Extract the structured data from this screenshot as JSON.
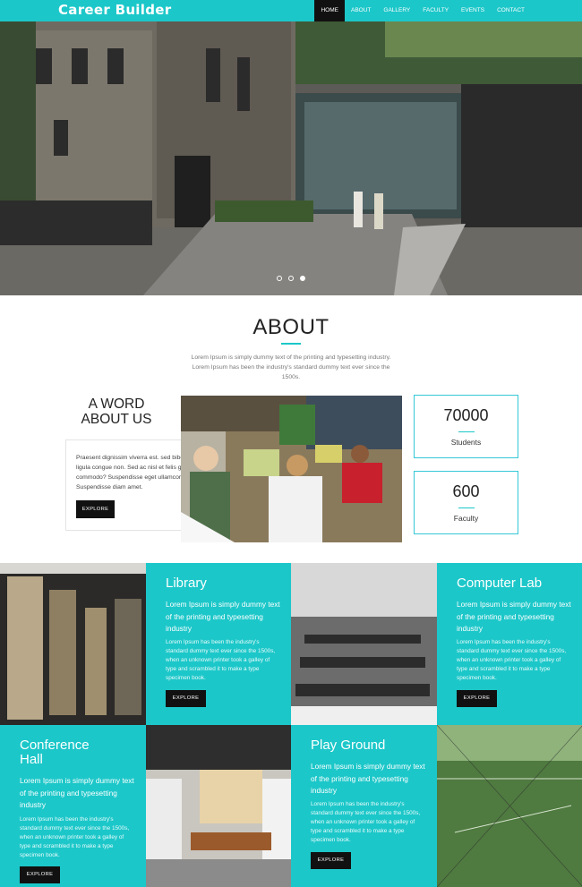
{
  "nav": {
    "logo": "Career Builder",
    "items": [
      "HOME",
      "ABOUT",
      "GALLERY",
      "FACULTY",
      "EVENTS",
      "CONTACT"
    ],
    "active_index": 0
  },
  "hero": {
    "slide_count": 3,
    "active_slide": 3
  },
  "about": {
    "title": "ABOUT",
    "text": "Lorem Ipsum is simply dummy text of the printing and typesetting industry. Lorem Ipsum has been the industry's standard dummy text ever since the 1500s.",
    "word_title_line1": "A WORD",
    "word_title_line2": "ABOUT US",
    "word_text": "Praesent dignissim viverra est. sed bibendum ligula congue non. Sed ac nisl et felis gravida commodo? Suspendisse eget ullamcorper sem. Suspendisse diam amet.",
    "explore_label": "EXPLORE"
  },
  "stats": [
    {
      "value": "70000",
      "label": "Students"
    },
    {
      "value": "600",
      "label": "Faculty"
    }
  ],
  "facilities": [
    {
      "title": "Library",
      "lead": "Lorem Ipsum is simply dummy text of the printing and typesetting industry",
      "body": "Lorem Ipsum has been the industry's standard dummy text ever since the 1500s, when an unknown printer took a galley of type and scrambled it to make a type specimen book.",
      "button": "EXPLORE"
    },
    {
      "title": "Computer Lab",
      "lead": "Lorem Ipsum is simply dummy text of the printing and typesetting industry",
      "body": "Lorem Ipsum has been the industry's standard dummy text ever since the 1500s, when an unknown printer took a galley of type and scrambled it to make a type specimen book.",
      "button": "EXPLORE"
    },
    {
      "title_line1": "Conference",
      "title_line2": "Hall",
      "lead": "Lorem Ipsum is simply dummy text of the printing and typesetting industry",
      "body": "Lorem Ipsum has been the industry's standard dummy text ever since the 1500s, when an unknown printer took a galley of type and scrambled it to make a type specimen book.",
      "button": "EXPLORE"
    },
    {
      "title": "Play Ground",
      "lead": "Lorem Ipsum is simply dummy text of the printing and typesetting industry",
      "body": "Lorem Ipsum has been the industry's standard dummy text ever since the 1500s, when an unknown printer took a galley of type and scrambled it to make a type specimen book.",
      "button": "EXPLORE"
    }
  ],
  "colors": {
    "accent": "#1cc7c9",
    "dark": "#111111"
  }
}
